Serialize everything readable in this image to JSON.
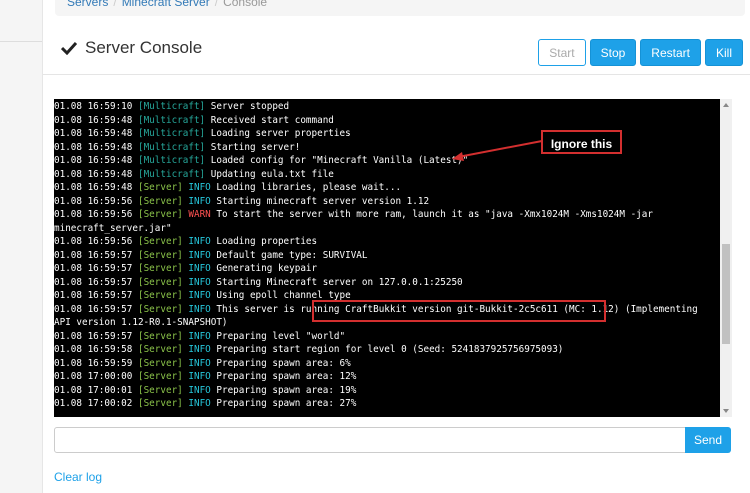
{
  "breadcrumb": [
    "Servers",
    "Minecraft Server",
    "Console"
  ],
  "page_title": "Server Console",
  "buttons": {
    "start": "Start",
    "stop": "Stop",
    "restart": "Restart",
    "kill": "Kill"
  },
  "console_lines": [
    {
      "ts": "01.08 16:59:10",
      "tag": "[Multicraft]",
      "lvl": "",
      "msg": "Server stopped"
    },
    {
      "ts": "01.08 16:59:48",
      "tag": "[Multicraft]",
      "lvl": "",
      "msg": "Received start command"
    },
    {
      "ts": "01.08 16:59:48",
      "tag": "[Multicraft]",
      "lvl": "",
      "msg": "Loading server properties"
    },
    {
      "ts": "01.08 16:59:48",
      "tag": "[Multicraft]",
      "lvl": "",
      "msg": "Starting server!"
    },
    {
      "ts": "01.08 16:59:48",
      "tag": "[Multicraft]",
      "lvl": "",
      "msg": "Loaded config for \"Minecraft Vanilla (Latest)\""
    },
    {
      "ts": "01.08 16:59:48",
      "tag": "[Multicraft]",
      "lvl": "",
      "msg": "Updating eula.txt file"
    },
    {
      "ts": "01.08 16:59:48",
      "tag": "[Server]",
      "lvl": "INFO",
      "msg": "Loading libraries, please wait..."
    },
    {
      "ts": "01.08 16:59:56",
      "tag": "[Server]",
      "lvl": "INFO",
      "msg": "Starting minecraft server version 1.12"
    },
    {
      "ts": "01.08 16:59:56",
      "tag": "[Server]",
      "lvl": "WARN",
      "msg": "To start the server with more ram, launch it as \"java -Xmx1024M -Xms1024M -jar minecraft_server.jar\""
    },
    {
      "ts": "01.08 16:59:56",
      "tag": "[Server]",
      "lvl": "INFO",
      "msg": "Loading properties"
    },
    {
      "ts": "01.08 16:59:57",
      "tag": "[Server]",
      "lvl": "INFO",
      "msg": "Default game type: SURVIVAL"
    },
    {
      "ts": "01.08 16:59:57",
      "tag": "[Server]",
      "lvl": "INFO",
      "msg": "Generating keypair"
    },
    {
      "ts": "01.08 16:59:57",
      "tag": "[Server]",
      "lvl": "INFO",
      "msg": "Starting Minecraft server on 127.0.0.1:25250"
    },
    {
      "ts": "01.08 16:59:57",
      "tag": "[Server]",
      "lvl": "INFO",
      "msg": "Using epoll channel type"
    },
    {
      "ts": "01.08 16:59:57",
      "tag": "[Server]",
      "lvl": "INFO",
      "msg": "This server is running CraftBukkit version git-Bukkit-2c5c611 (MC: 1.12) (Implementing API version 1.12-R0.1-SNAPSHOT)"
    },
    {
      "ts": "01.08 16:59:57",
      "tag": "[Server]",
      "lvl": "INFO",
      "msg": "Preparing level \"world\""
    },
    {
      "ts": "01.08 16:59:58",
      "tag": "[Server]",
      "lvl": "INFO",
      "msg": "Preparing start region for level 0 (Seed: 5241837925756975093)"
    },
    {
      "ts": "01.08 16:59:59",
      "tag": "[Server]",
      "lvl": "INFO",
      "msg": "Preparing spawn area: 6%"
    },
    {
      "ts": "01.08 17:00:00",
      "tag": "[Server]",
      "lvl": "INFO",
      "msg": "Preparing spawn area: 12%"
    },
    {
      "ts": "01.08 17:00:01",
      "tag": "[Server]",
      "lvl": "INFO",
      "msg": "Preparing spawn area: 19%"
    },
    {
      "ts": "01.08 17:00:02",
      "tag": "[Server]",
      "lvl": "INFO",
      "msg": "Preparing spawn area: 27%"
    }
  ],
  "annotation": "Ignore this",
  "send_label": "Send",
  "clear_log": "Clear log",
  "colors": {
    "accent": "#1ea1e8",
    "annotation_red": "#d32f2f",
    "console_bg": "#000000"
  }
}
